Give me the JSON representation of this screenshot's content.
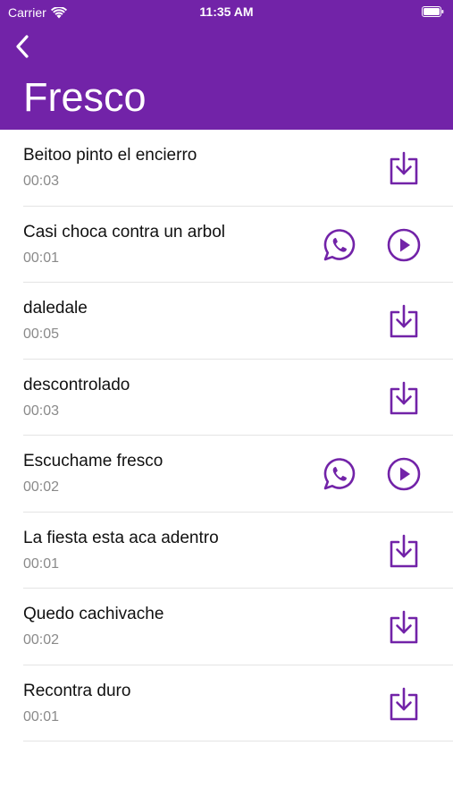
{
  "status_bar": {
    "carrier": "Carrier",
    "time": "11:35 AM"
  },
  "header": {
    "title": "Fresco",
    "back_icon": "chevron-left-icon",
    "background_color": "#7223a8"
  },
  "accent_color": "#7223a8",
  "items": [
    {
      "title": "Beitoo pinto el encierro",
      "duration": "00:03",
      "state": "download"
    },
    {
      "title": "Casi choca contra un arbol",
      "duration": "00:01",
      "state": "downloaded"
    },
    {
      "title": "daledale",
      "duration": "00:05",
      "state": "download"
    },
    {
      "title": "descontrolado",
      "duration": "00:03",
      "state": "download"
    },
    {
      "title": "Escuchame fresco",
      "duration": "00:02",
      "state": "downloaded"
    },
    {
      "title": "La fiesta esta aca adentro",
      "duration": "00:01",
      "state": "download"
    },
    {
      "title": "Quedo cachivache",
      "duration": "00:02",
      "state": "download"
    },
    {
      "title": "Recontra duro",
      "duration": "00:01",
      "state": "download"
    }
  ]
}
